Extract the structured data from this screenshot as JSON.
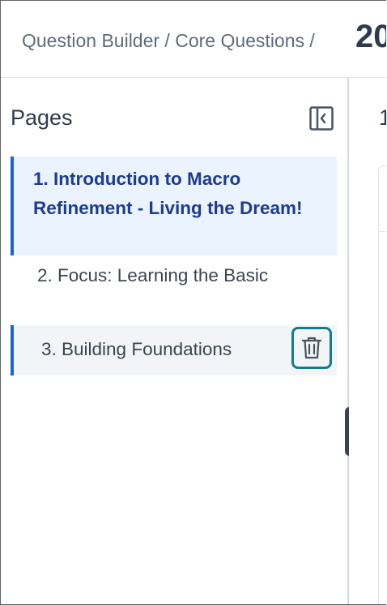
{
  "header": {
    "breadcrumb": "Question Builder / Core Questions /",
    "title_fragment": "20"
  },
  "sidebar": {
    "heading": "Pages",
    "collapse_icon": "sidebar-collapse-icon",
    "pages": [
      {
        "label": "1. Introduction to Macro Refinement - Living the Dream!",
        "state": "selected"
      },
      {
        "label": "2. Focus: Learning the Basic",
        "state": "normal"
      },
      {
        "label": "3. Building Foundations",
        "state": "hovered",
        "action_icon": "trash-icon"
      }
    ]
  },
  "main": {
    "heading_fragment": "1"
  },
  "colors": {
    "accent": "#1b63d4",
    "selected_bg": "#eaf3fe",
    "selected_text": "#1d3b8f",
    "highlight_outline": "#147d8c"
  }
}
